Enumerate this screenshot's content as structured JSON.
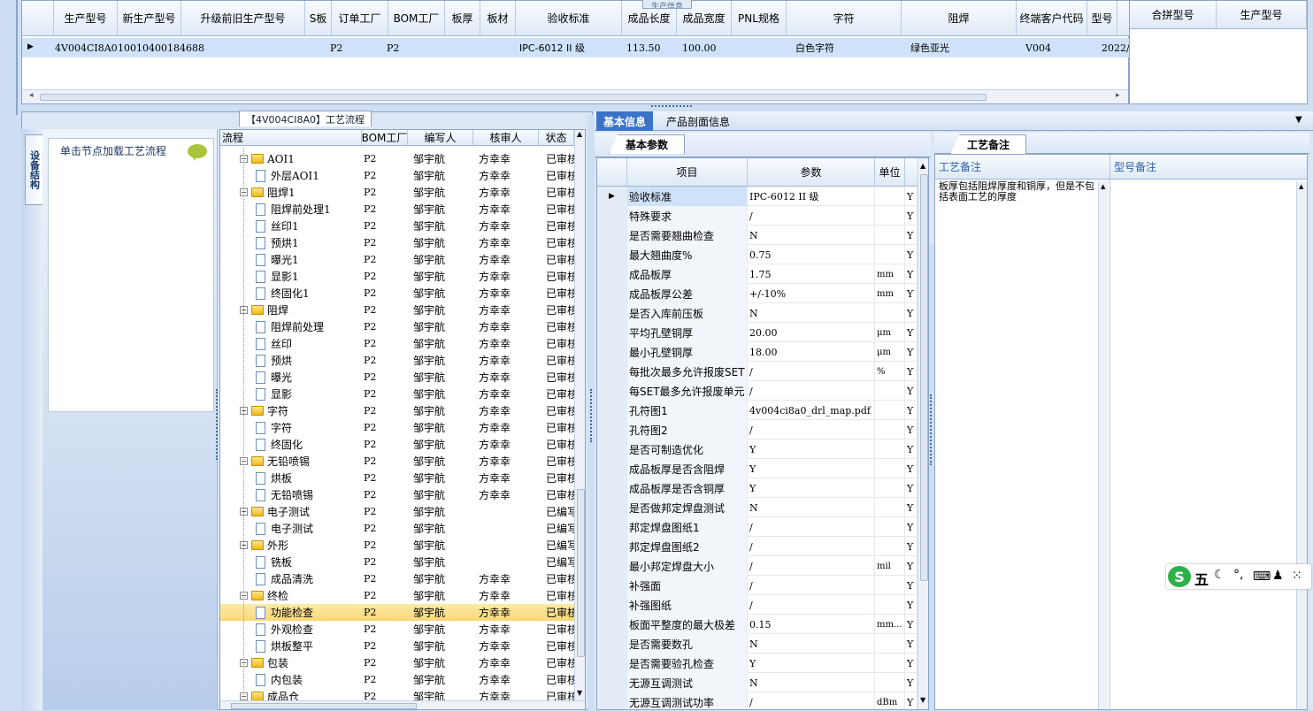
{
  "top_grid": {
    "tab_label": "生产信息",
    "columns": [
      "生产型号",
      "新生产型号",
      "升级前旧生产型号",
      "S板",
      "订单工厂",
      "BOM工厂",
      "板厚",
      "板材",
      "验收标准",
      "成品长度",
      "成品宽度",
      "PNL规格",
      "字符",
      "阻焊",
      "终端客户代码",
      "型号"
    ],
    "row": {
      "prod_no": "4V004CI8A0",
      "new_prod_no": "10010400184688",
      "order_factory": "P2",
      "bom_factory": "P2",
      "standard": "IPC-6012 II 级",
      "length": "113.50",
      "width": "100.00",
      "char": "白色字符",
      "solder": "绿色亚光",
      "customer": "V004",
      "date": "2022/"
    }
  },
  "merge_panel": {
    "columns": [
      "合拼型号",
      "生产型号"
    ]
  },
  "flow_title": "【4V004CI8A0】工艺流程",
  "left_tab": "设备结构",
  "left_panel": {
    "load_hint": "单击节点加载工艺流程"
  },
  "tree": {
    "columns": [
      "流程",
      "BOM工厂",
      "编写人",
      "核审人",
      "状态"
    ],
    "rows": [
      {
        "name": "AOI1",
        "type": "folder",
        "level": 1,
        "bom": "P2",
        "author": "邹宇航",
        "reviewer": "方幸幸",
        "status": "已审核"
      },
      {
        "name": "外层AOI1",
        "type": "doc",
        "level": 2,
        "bom": "P2",
        "author": "邹宇航",
        "reviewer": "方幸幸",
        "status": "已审核"
      },
      {
        "name": "阻焊1",
        "type": "folder",
        "level": 1,
        "bom": "P2",
        "author": "邹宇航",
        "reviewer": "方幸幸",
        "status": "已审核"
      },
      {
        "name": "阻焊前处理1",
        "type": "doc",
        "level": 2,
        "bom": "P2",
        "author": "邹宇航",
        "reviewer": "方幸幸",
        "status": "已审核"
      },
      {
        "name": "丝印1",
        "type": "doc",
        "level": 2,
        "bom": "P2",
        "author": "邹宇航",
        "reviewer": "方幸幸",
        "status": "已审核"
      },
      {
        "name": "预烘1",
        "type": "doc",
        "level": 2,
        "bom": "P2",
        "author": "邹宇航",
        "reviewer": "方幸幸",
        "status": "已审核"
      },
      {
        "name": "曝光1",
        "type": "doc",
        "level": 2,
        "bom": "P2",
        "author": "邹宇航",
        "reviewer": "方幸幸",
        "status": "已审核"
      },
      {
        "name": "显影1",
        "type": "doc",
        "level": 2,
        "bom": "P2",
        "author": "邹宇航",
        "reviewer": "方幸幸",
        "status": "已审核"
      },
      {
        "name": "终固化1",
        "type": "doc",
        "level": 2,
        "bom": "P2",
        "author": "邹宇航",
        "reviewer": "方幸幸",
        "status": "已审核"
      },
      {
        "name": "阻焊",
        "type": "folder",
        "level": 1,
        "bom": "P2",
        "author": "邹宇航",
        "reviewer": "方幸幸",
        "status": "已审核"
      },
      {
        "name": "阻焊前处理",
        "type": "doc",
        "level": 2,
        "bom": "P2",
        "author": "邹宇航",
        "reviewer": "方幸幸",
        "status": "已审核"
      },
      {
        "name": "丝印",
        "type": "doc",
        "level": 2,
        "bom": "P2",
        "author": "邹宇航",
        "reviewer": "方幸幸",
        "status": "已审核"
      },
      {
        "name": "预烘",
        "type": "doc",
        "level": 2,
        "bom": "P2",
        "author": "邹宇航",
        "reviewer": "方幸幸",
        "status": "已审核"
      },
      {
        "name": "曝光",
        "type": "doc",
        "level": 2,
        "bom": "P2",
        "author": "邹宇航",
        "reviewer": "方幸幸",
        "status": "已审核"
      },
      {
        "name": "显影",
        "type": "doc",
        "level": 2,
        "bom": "P2",
        "author": "邹宇航",
        "reviewer": "方幸幸",
        "status": "已审核"
      },
      {
        "name": "字符",
        "type": "folder",
        "level": 1,
        "bom": "P2",
        "author": "邹宇航",
        "reviewer": "方幸幸",
        "status": "已审核"
      },
      {
        "name": "字符",
        "type": "doc",
        "level": 2,
        "bom": "P2",
        "author": "邹宇航",
        "reviewer": "方幸幸",
        "status": "已审核"
      },
      {
        "name": "终固化",
        "type": "doc",
        "level": 2,
        "bom": "P2",
        "author": "邹宇航",
        "reviewer": "方幸幸",
        "status": "已审核"
      },
      {
        "name": "无铅喷锡",
        "type": "folder",
        "level": 1,
        "bom": "P2",
        "author": "邹宇航",
        "reviewer": "方幸幸",
        "status": "已审核"
      },
      {
        "name": "烘板",
        "type": "doc",
        "level": 2,
        "bom": "P2",
        "author": "邹宇航",
        "reviewer": "方幸幸",
        "status": "已审核"
      },
      {
        "name": "无铅喷锡",
        "type": "doc",
        "level": 2,
        "bom": "P2",
        "author": "邹宇航",
        "reviewer": "方幸幸",
        "status": "已审核"
      },
      {
        "name": "电子测试",
        "type": "folder",
        "level": 1,
        "bom": "P2",
        "author": "邹宇航",
        "reviewer": "",
        "status": "已编写"
      },
      {
        "name": "电子测试",
        "type": "doc",
        "level": 2,
        "bom": "P2",
        "author": "邹宇航",
        "reviewer": "",
        "status": "已编写"
      },
      {
        "name": "外形",
        "type": "folder",
        "level": 1,
        "bom": "P2",
        "author": "邹宇航",
        "reviewer": "",
        "status": "已编写"
      },
      {
        "name": "铣板",
        "type": "doc",
        "level": 2,
        "bom": "P2",
        "author": "邹宇航",
        "reviewer": "",
        "status": "已编写"
      },
      {
        "name": "成品清洗",
        "type": "doc",
        "level": 2,
        "bom": "P2",
        "author": "邹宇航",
        "reviewer": "方幸幸",
        "status": "已审核"
      },
      {
        "name": "终检",
        "type": "folder",
        "level": 1,
        "bom": "P2",
        "author": "邹宇航",
        "reviewer": "方幸幸",
        "status": "已审核"
      },
      {
        "name": "功能检查",
        "type": "doc",
        "level": 2,
        "bom": "P2",
        "author": "邹宇航",
        "reviewer": "方幸幸",
        "status": "已审核",
        "selected": true
      },
      {
        "name": "外观检查",
        "type": "doc",
        "level": 2,
        "bom": "P2",
        "author": "邹宇航",
        "reviewer": "方幸幸",
        "status": "已审核"
      },
      {
        "name": "烘板整平",
        "type": "doc",
        "level": 2,
        "bom": "P2",
        "author": "邹宇航",
        "reviewer": "方幸幸",
        "status": "已审核"
      },
      {
        "name": "包装",
        "type": "folder",
        "level": 1,
        "bom": "P2",
        "author": "邹宇航",
        "reviewer": "方幸幸",
        "status": "已审核"
      },
      {
        "name": "内包装",
        "type": "doc",
        "level": 2,
        "bom": "P2",
        "author": "邹宇航",
        "reviewer": "方幸幸",
        "status": "已审核"
      },
      {
        "name": "成品仓",
        "type": "folder",
        "level": 1,
        "bom": "P2",
        "author": "邹宇航",
        "reviewer": "方幸幸",
        "status": "已审核"
      }
    ]
  },
  "right_tabs": {
    "basic_info": "基本信息",
    "profile_info": "产品剖面信息"
  },
  "params_tab": "基本参数",
  "notes_tab": "工艺备注",
  "params": {
    "columns": [
      "项目",
      "参数",
      "单位"
    ],
    "rows": [
      {
        "item": "验收标准",
        "value": "IPC-6012 II 级",
        "unit": "",
        "flag": "Y"
      },
      {
        "item": "特殊要求",
        "value": "/",
        "unit": "",
        "flag": "Y"
      },
      {
        "item": "是否需要翘曲检查",
        "value": "N",
        "unit": "",
        "flag": "Y"
      },
      {
        "item": "最大翘曲度%",
        "value": "0.75",
        "unit": "",
        "flag": "Y"
      },
      {
        "item": "成品板厚",
        "value": "1.75",
        "unit": "mm",
        "flag": "Y"
      },
      {
        "item": "成品板厚公差",
        "value": "+/-10%",
        "unit": "mm",
        "flag": "Y"
      },
      {
        "item": "是否入库前压板",
        "value": "N",
        "unit": "",
        "flag": "Y"
      },
      {
        "item": "平均孔壁铜厚",
        "value": "20.00",
        "unit": "μm",
        "flag": "Y"
      },
      {
        "item": "最小孔壁铜厚",
        "value": "18.00",
        "unit": "μm",
        "flag": "Y"
      },
      {
        "item": "每批次最多允许报废SET",
        "value": "/",
        "unit": "%",
        "flag": "Y"
      },
      {
        "item": "每SET最多允许报废单元",
        "value": "/",
        "unit": "",
        "flag": "Y"
      },
      {
        "item": "孔符图1",
        "value": "4v004ci8a0_drl_map.pdf",
        "unit": "",
        "flag": "Y"
      },
      {
        "item": "孔符图2",
        "value": "/",
        "unit": "",
        "flag": "Y"
      },
      {
        "item": "是否可制造优化",
        "value": "Y",
        "unit": "",
        "flag": "Y"
      },
      {
        "item": "成品板厚是否含阻焊",
        "value": "Y",
        "unit": "",
        "flag": "Y"
      },
      {
        "item": "成品板厚是否含铜厚",
        "value": "Y",
        "unit": "",
        "flag": "Y"
      },
      {
        "item": "是否做邦定焊盘测试",
        "value": "N",
        "unit": "",
        "flag": "Y"
      },
      {
        "item": "邦定焊盘图纸1",
        "value": "/",
        "unit": "",
        "flag": "Y"
      },
      {
        "item": "邦定焊盘图纸2",
        "value": "/",
        "unit": "",
        "flag": "Y"
      },
      {
        "item": "最小邦定焊盘大小",
        "value": "/",
        "unit": "mil",
        "flag": "Y"
      },
      {
        "item": "补强面",
        "value": "/",
        "unit": "",
        "flag": "Y"
      },
      {
        "item": "补强图纸",
        "value": "/",
        "unit": "",
        "flag": "Y"
      },
      {
        "item": "板面平整度的最大极差",
        "value": "0.15",
        "unit": "mm...",
        "flag": "Y"
      },
      {
        "item": "是否需要数孔",
        "value": "N",
        "unit": "",
        "flag": "Y"
      },
      {
        "item": "是否需要验孔检查",
        "value": "Y",
        "unit": "",
        "flag": "Y"
      },
      {
        "item": "无源互调测试",
        "value": "N",
        "unit": "",
        "flag": "Y"
      },
      {
        "item": "无源互调测试功率",
        "value": "/",
        "unit": "dBm",
        "flag": "Y"
      }
    ]
  },
  "notes": {
    "col_process": "工艺备注",
    "col_model": "型号备注",
    "process_note": "板厚包括阻焊厚度和铜厚，但是不包括表面工艺的厚度"
  },
  "ime": {
    "label": "五",
    "icons": [
      "moon-icon",
      "punct-icon",
      "keyboard-icon",
      "user-icon",
      "grid-icon"
    ]
  },
  "colors": {
    "selected_row": "#cfe2fa",
    "highlight_row": "#fbd875",
    "tab_active": "#3b73c9"
  }
}
